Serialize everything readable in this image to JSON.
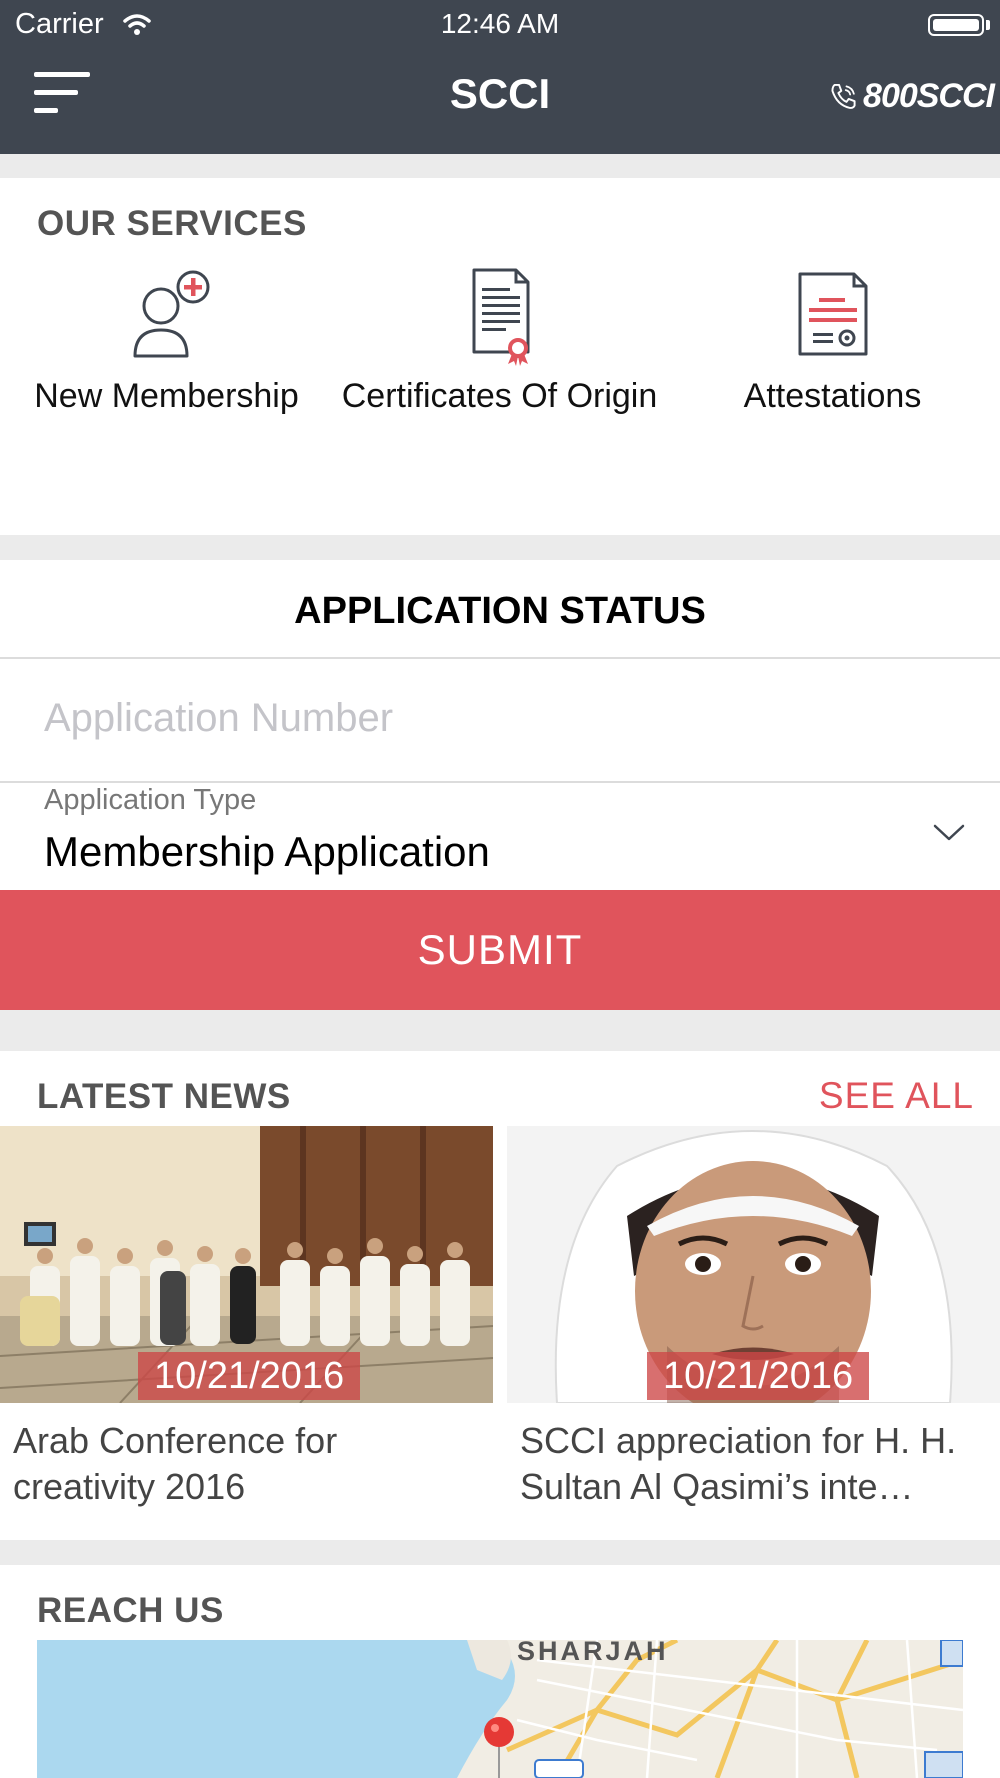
{
  "status_bar": {
    "carrier": "Carrier",
    "time": "12:46 AM"
  },
  "header": {
    "title": "SCCI",
    "hotline": "800SCCI"
  },
  "services": {
    "title": "OUR SERVICES",
    "items": [
      {
        "label": "New Membership",
        "icon": "user-add-icon"
      },
      {
        "label": "Certificates Of Origin",
        "icon": "certificate-icon"
      },
      {
        "label": "Attestations",
        "icon": "attestation-document-icon"
      }
    ]
  },
  "application_status": {
    "title": "APPLICATION STATUS",
    "number_placeholder": "Application Number",
    "type_label": "Application Type",
    "type_value": "Membership Application",
    "submit_label": "SUBMIT"
  },
  "news": {
    "title": "LATEST NEWS",
    "see_all": "SEE ALL",
    "items": [
      {
        "date": "10/21/2016",
        "caption": "Arab Conference for creativity 2016"
      },
      {
        "date": "10/21/2016",
        "caption": "SCCI appreciation for H. H. Sultan Al Qasimi’s inte…"
      }
    ]
  },
  "reach_us": {
    "title": "REACH US",
    "map_label": "SHARJAH"
  },
  "colors": {
    "header": "#3f4650",
    "accent": "#e0545c",
    "background": "#ebebeb"
  }
}
